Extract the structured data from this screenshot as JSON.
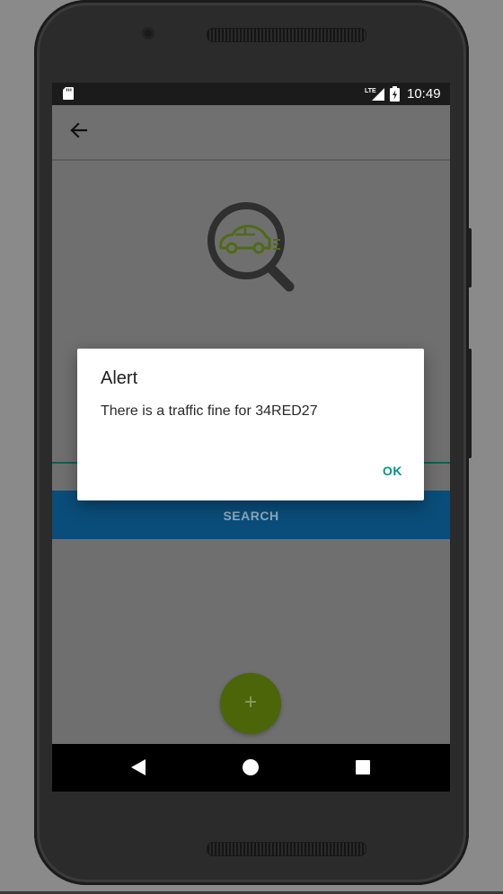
{
  "status_bar": {
    "network": "LTE",
    "time": "10:49",
    "icons": [
      "sd-card-icon",
      "lte-signal-icon",
      "battery-charging-icon"
    ]
  },
  "toolbar": {
    "back_icon": "arrow-left-icon"
  },
  "logo": {
    "icon": "car-search-icon",
    "accent": "#5b7a1a"
  },
  "search": {
    "button_label": "SEARCH"
  },
  "fab": {
    "label": "+"
  },
  "dialog": {
    "title": "Alert",
    "message": "There is a traffic fine for 34RED27",
    "ok_label": "OK"
  },
  "nav_bar": {
    "icons": [
      "back-triangle-icon",
      "home-circle-icon",
      "recents-square-icon"
    ]
  },
  "colors": {
    "accent_teal": "#009688",
    "search_blue": "#0a4d7a",
    "fab_green": "#4b6508",
    "scrim": "#6f6f6f"
  }
}
